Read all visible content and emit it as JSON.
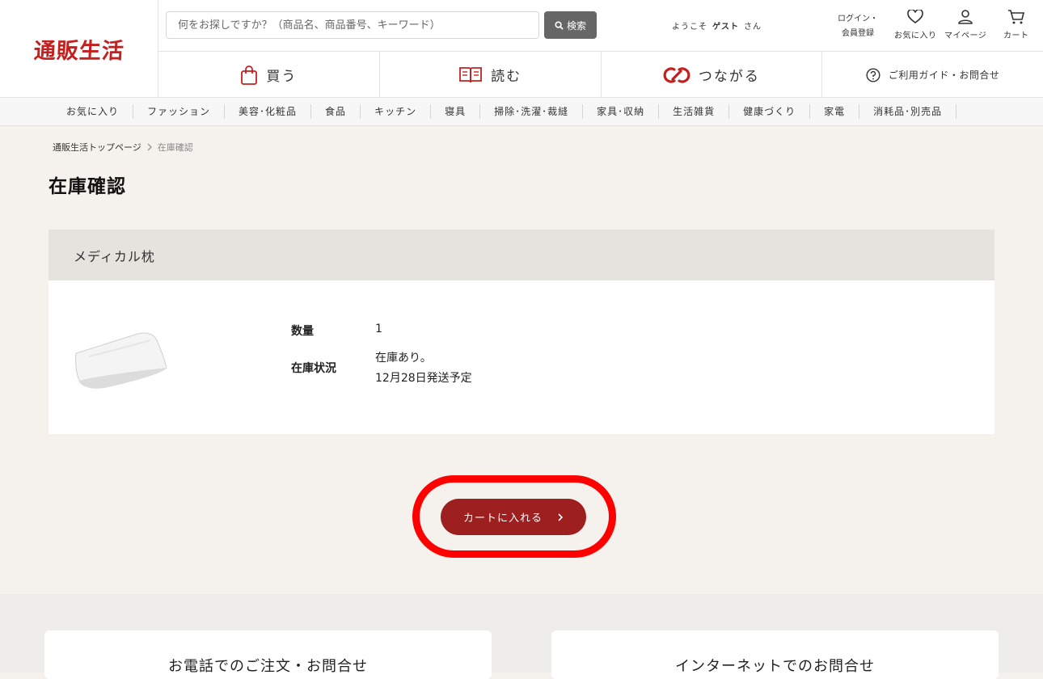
{
  "header": {
    "logo": "通販生活",
    "search_placeholder": "何をお探しですか？（商品名、商品番号、キーワード）",
    "search_button": "検索",
    "welcome_prefix": "ようこそ",
    "welcome_user": "ゲスト",
    "welcome_suffix": "さん",
    "login_line1": "ログイン・",
    "login_line2": "会員登録",
    "favorites": "お気に入り",
    "mypage": "マイページ",
    "cart": "カート"
  },
  "nav": {
    "buy": "買う",
    "read": "読む",
    "connect": "つながる",
    "guide": "ご利用ガイド・お問合せ"
  },
  "categories": [
    "お気に入り",
    "ファッション",
    "美容･化粧品",
    "食品",
    "キッチン",
    "寝具",
    "掃除･洗濯･裁縫",
    "家具･収納",
    "生活雑貨",
    "健康づくり",
    "家電",
    "消耗品･別売品"
  ],
  "breadcrumb": {
    "home": "通販生活トップページ",
    "current": "在庫確認"
  },
  "page_title": "在庫確認",
  "product": {
    "name": "メディカル枕",
    "qty_label": "数量",
    "qty_value": "1",
    "stock_label": "在庫状況",
    "stock_line1": "在庫あり。",
    "stock_line2": "12月28日発送予定"
  },
  "actions": {
    "add_to_cart": "カートに入れる"
  },
  "footer": {
    "phone": "お電話でのご注文・お問合せ",
    "internet": "インターネットでのお問合せ"
  },
  "colors": {
    "brand": "#c4201f",
    "cart_button": "#9d1f1f",
    "highlight": "#ff0000"
  }
}
